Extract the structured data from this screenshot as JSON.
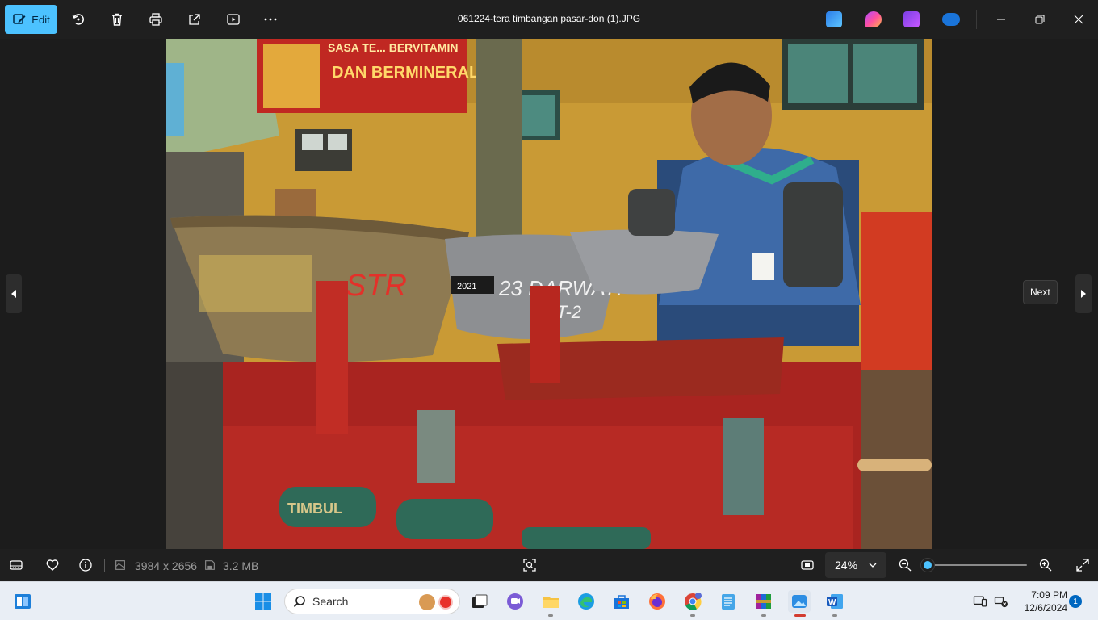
{
  "toolbar": {
    "edit_label": "Edit",
    "title": "061224-tera timbangan pasar-don  (1).JPG"
  },
  "photo": {
    "banner_line1": "SASA TE... BERVITAMIN",
    "banner_line2": "DAN BERMINERAL",
    "bowl1_text": "STR",
    "bowl2_text": "23 DARWATI",
    "bowl2_text2": "AT-2",
    "sticker_text": "2021",
    "brand_text": "TIMBUL"
  },
  "viewer": {
    "tooltip": "Next"
  },
  "bottombar": {
    "dimensions": "3984 x 2656",
    "file_size": "3.2 MB",
    "zoom_value": "24%",
    "zoom_level_fraction": 0.02
  },
  "taskbar": {
    "search_placeholder": "Search",
    "time": "7:09 PM",
    "date": "12/6/2024",
    "notification_count": "1"
  },
  "colors": {
    "accent": "#4cc2ff",
    "toolbar_bg": "#1f1f1f",
    "taskbar_bg": "#e9eef5"
  }
}
